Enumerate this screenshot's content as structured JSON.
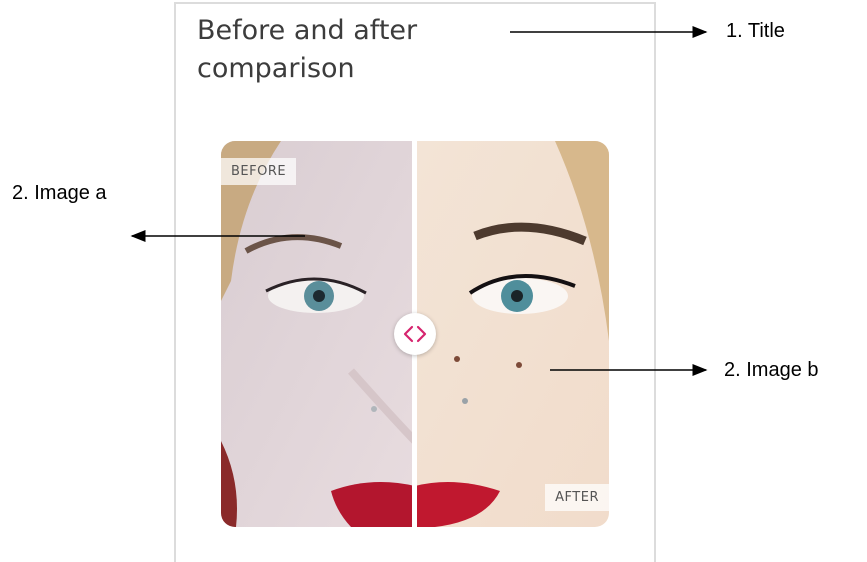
{
  "title": "Before and after comparison",
  "comparison": {
    "before_label": "BEFORE",
    "after_label": "AFTER",
    "handle_icon": "left-right-chevrons-icon",
    "accent_color": "#d6246e",
    "divider_position": 0.5
  },
  "annotations": {
    "title_label": "1. Title",
    "image_a_label": "2. Image a",
    "image_b_label": "2. Image b"
  }
}
